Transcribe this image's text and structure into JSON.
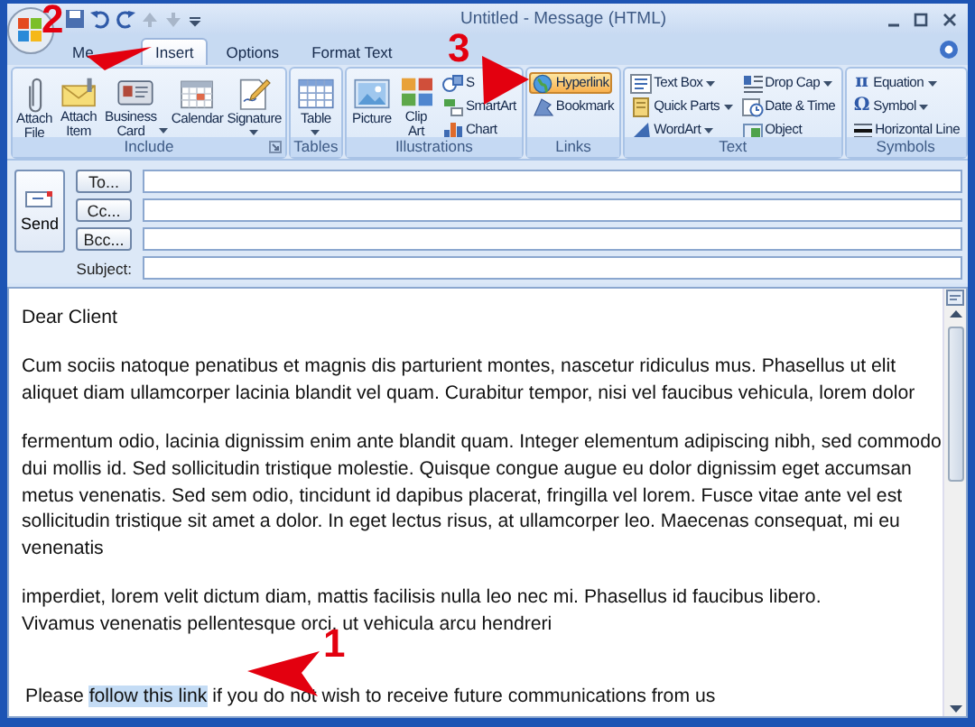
{
  "window": {
    "title": "Untitled - Message (HTML)"
  },
  "tabs": [
    {
      "label": "Me",
      "selected": false
    },
    {
      "label": "Insert",
      "selected": true
    },
    {
      "label": "Options",
      "selected": false
    },
    {
      "label": "Format Text",
      "selected": false
    }
  ],
  "ribbon": {
    "groups": [
      {
        "label": "Include",
        "launcher": true,
        "items": [
          {
            "kind": "large",
            "label": "Attach File",
            "dropdown": false,
            "highlighted": false
          },
          {
            "kind": "large",
            "label": "Attach Item",
            "dropdown": false,
            "highlighted": false
          },
          {
            "kind": "large",
            "label": "Business Card",
            "dropdown": true,
            "highlighted": false
          },
          {
            "kind": "large",
            "label": "Calendar",
            "dropdown": false,
            "highlighted": false
          },
          {
            "kind": "large",
            "label": "Signature",
            "dropdown": true,
            "highlighted": false
          }
        ]
      },
      {
        "label": "Tables",
        "launcher": false,
        "items": [
          {
            "kind": "large",
            "label": "Table",
            "dropdown": true,
            "highlighted": false
          }
        ]
      },
      {
        "label": "Illustrations",
        "launcher": false,
        "items": [
          {
            "kind": "large",
            "label": "Picture",
            "dropdown": false,
            "highlighted": false
          },
          {
            "kind": "large",
            "label": "Clip Art",
            "dropdown": false,
            "highlighted": false
          },
          {
            "kind": "small",
            "label": "S",
            "dropdown": false,
            "highlighted": false
          },
          {
            "kind": "small",
            "label": "SmartArt",
            "dropdown": false,
            "highlighted": false
          },
          {
            "kind": "small",
            "label": "Chart",
            "dropdown": false,
            "highlighted": false
          }
        ]
      },
      {
        "label": "Links",
        "launcher": false,
        "items": [
          {
            "kind": "small",
            "label": "Hyperlink",
            "dropdown": false,
            "highlighted": true
          },
          {
            "kind": "small",
            "label": "Bookmark",
            "dropdown": false,
            "highlighted": false
          }
        ]
      },
      {
        "label": "Text",
        "launcher": false,
        "items": [
          {
            "kind": "small",
            "label": "Text Box",
            "dropdown": true,
            "highlighted": false
          },
          {
            "kind": "small",
            "label": "Quick Parts",
            "dropdown": true,
            "highlighted": false
          },
          {
            "kind": "small",
            "label": "WordArt",
            "dropdown": true,
            "highlighted": false
          },
          {
            "kind": "small",
            "label": "Drop Cap",
            "dropdown": true,
            "highlighted": false
          },
          {
            "kind": "small",
            "label": "Date & Time",
            "dropdown": false,
            "highlighted": false
          },
          {
            "kind": "small",
            "label": "Object",
            "dropdown": false,
            "highlighted": false
          }
        ]
      },
      {
        "label": "Symbols",
        "launcher": false,
        "items": [
          {
            "kind": "small",
            "label": "Equation",
            "glyph": "π",
            "dropdown": true,
            "highlighted": false
          },
          {
            "kind": "small",
            "label": "Symbol",
            "glyph": "Ω",
            "dropdown": true,
            "highlighted": false
          },
          {
            "kind": "small",
            "label": "Horizontal Line",
            "dropdown": false,
            "highlighted": false
          }
        ]
      }
    ]
  },
  "header": {
    "send": "Send",
    "recipients": [
      {
        "button": "To..."
      },
      {
        "button": "Cc..."
      },
      {
        "button": "Bcc..."
      }
    ],
    "subject_label": "Subject:"
  },
  "body": {
    "paragraphs": [
      [
        "Dear Client"
      ],
      [
        "Cum sociis natoque penatibus et magnis dis parturient montes, nascetur ridiculus mus. Phasellus ut elit",
        "aliquet diam ullamcorper lacinia blandit vel quam. Curabitur tempor, nisi vel faucibus vehicula, lorem dolor"
      ],
      [
        "fermentum odio, lacinia dignissim enim ante blandit quam. Integer elementum adipiscing nibh, sed commodo",
        "dui mollis id. Sed sollicitudin tristique molestie. Quisque congue augue eu dolor dignissim eget accumsan",
        "metus venenatis. Sed sem odio, tincidunt id dapibus placerat, fringilla vel lorem. Fusce vitae ante vel est",
        "sollicitudin tristique sit amet a dolor. In eget lectus risus, at ullamcorper leo. Maecenas consequat, mi eu",
        "venenatis"
      ],
      [
        "imperdiet, lorem velit dictum diam, mattis facilisis nulla leo nec mi. Phasellus id faucibus libero.",
        "Vivamus venenatis pellentesque orci, ut vehicula arcu hendreri"
      ]
    ],
    "closing": {
      "before": "Please",
      "link": "follow this link",
      "link_selected": true,
      "after": "if you do not wish to receive future communications from us"
    }
  },
  "annotations": [
    {
      "number": "2"
    },
    {
      "number": "3"
    },
    {
      "number": "1"
    }
  ]
}
